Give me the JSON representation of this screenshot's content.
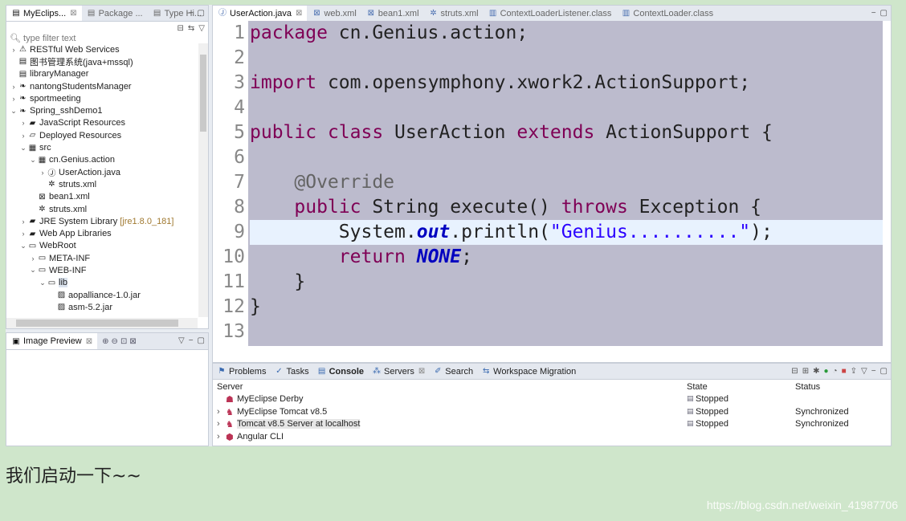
{
  "explorer": {
    "tabs": [
      {
        "label": "MyEclips...",
        "icon": "myeclipse-icon",
        "close": "⊠"
      },
      {
        "label": "Package ...",
        "icon": "package-explorer-icon"
      },
      {
        "label": "Type Hi...",
        "icon": "type-hierarchy-icon"
      }
    ],
    "filter_placeholder": "type filter text",
    "tree": [
      {
        "label": "RESTful Web Services",
        "arrow": "›",
        "icon": "⚠"
      },
      {
        "label": "图书管理系统(java+mssql)",
        "arrow": "",
        "icon": "▤"
      },
      {
        "label": "libraryManager",
        "arrow": "",
        "icon": "▤"
      },
      {
        "label": "nantongStudentsManager",
        "arrow": "›",
        "icon": "❧"
      },
      {
        "label": "sportmeeting",
        "arrow": "›",
        "icon": "❧"
      },
      {
        "label": "Spring_sshDemo1",
        "arrow": "⌄",
        "icon": "❧"
      },
      {
        "label": "JavaScript Resources",
        "arrow": "›",
        "icon": "▰"
      },
      {
        "label": "Deployed Resources",
        "arrow": "›",
        "icon": "▱"
      },
      {
        "label": "src",
        "arrow": "⌄",
        "icon": "▦"
      },
      {
        "label": "cn.Genius.action",
        "arrow": "⌄",
        "icon": "▦"
      },
      {
        "label": "UserAction.java",
        "arrow": "›",
        "icon": "Ⓙ"
      },
      {
        "label": "struts.xml",
        "arrow": "",
        "icon": "✲"
      },
      {
        "label": "bean1.xml",
        "arrow": "",
        "icon": "⊠"
      },
      {
        "label": "struts.xml",
        "arrow": "",
        "icon": "✲"
      },
      {
        "label": "JRE System Library",
        "decoration": "[jre1.8.0_181]",
        "arrow": "›",
        "icon": "▰"
      },
      {
        "label": "Web App Libraries",
        "arrow": "›",
        "icon": "▰"
      },
      {
        "label": "WebRoot",
        "arrow": "⌄",
        "icon": "▭"
      },
      {
        "label": "META-INF",
        "arrow": "›",
        "icon": "▭"
      },
      {
        "label": "WEB-INF",
        "arrow": "⌄",
        "icon": "▭"
      },
      {
        "label": "lib",
        "arrow": "⌄",
        "icon": "▭",
        "selected": true
      },
      {
        "label": "aopalliance-1.0.jar",
        "arrow": "",
        "icon": "▨"
      },
      {
        "label": "asm-5.2.jar",
        "arrow": "",
        "icon": "▨"
      }
    ]
  },
  "image_preview": {
    "title": "Image Preview",
    "close": "⊠"
  },
  "editor": {
    "tabs": [
      {
        "label": "UserAction.java",
        "icon": "Ⓙ",
        "active": true,
        "close": "⊠"
      },
      {
        "label": "web.xml",
        "icon": "⊠"
      },
      {
        "label": "bean1.xml",
        "icon": "⊠"
      },
      {
        "label": "struts.xml",
        "icon": "✲"
      },
      {
        "label": "ContextLoaderListener.class",
        "icon": "▥"
      },
      {
        "label": "ContextLoader.class",
        "icon": "▥"
      }
    ],
    "line_numbers": [
      "1",
      "2",
      "3",
      "4",
      "5",
      "6",
      "7",
      "8",
      "9",
      "10",
      "11",
      "12",
      "13"
    ],
    "current_line": 9,
    "code_lines": [
      [
        {
          "t": "package",
          "c": "kw"
        },
        {
          "t": " cn.Genius.action;"
        }
      ],
      [],
      [
        {
          "t": "import",
          "c": "kw"
        },
        {
          "t": " com.opensymphony.xwork2.ActionSupport;"
        }
      ],
      [],
      [
        {
          "t": "public",
          "c": "kw"
        },
        {
          "t": " "
        },
        {
          "t": "class",
          "c": "kw"
        },
        {
          "t": " UserAction "
        },
        {
          "t": "extends",
          "c": "kw"
        },
        {
          "t": " ActionSupport {"
        }
      ],
      [],
      [
        {
          "t": "    "
        },
        {
          "t": "@Override",
          "c": "an"
        }
      ],
      [
        {
          "t": "    "
        },
        {
          "t": "public",
          "c": "kw"
        },
        {
          "t": " String execute() "
        },
        {
          "t": "throws",
          "c": "kw"
        },
        {
          "t": " Exception {"
        }
      ],
      [
        {
          "t": "        System."
        },
        {
          "t": "out",
          "c": "fld"
        },
        {
          "t": ".println("
        },
        {
          "t": "\"Genius..........\"",
          "c": "st"
        },
        {
          "t": ");"
        }
      ],
      [
        {
          "t": "        "
        },
        {
          "t": "return",
          "c": "kw"
        },
        {
          "t": " "
        },
        {
          "t": "NONE",
          "c": "fld"
        },
        {
          "t": ";"
        }
      ],
      [
        {
          "t": "    }"
        }
      ],
      [
        {
          "t": "}"
        }
      ],
      []
    ]
  },
  "bottom": {
    "tabs": [
      {
        "label": "Problems",
        "icon": "⚑"
      },
      {
        "label": "Tasks",
        "icon": "✓"
      },
      {
        "label": "Console",
        "icon": "▤",
        "bold": true
      },
      {
        "label": "Servers",
        "icon": "⁂",
        "close": "⊠"
      },
      {
        "label": "Search",
        "icon": "✐"
      },
      {
        "label": "Workspace Migration",
        "icon": "⇆"
      }
    ],
    "columns": [
      "Server",
      "State",
      "Status"
    ],
    "rows": [
      {
        "name": "MyEclipse Derby",
        "arrow": "",
        "icon": "☗",
        "state": "Stopped",
        "status": ""
      },
      {
        "name": "MyEclipse Tomcat v8.5",
        "arrow": "›",
        "icon": "♞",
        "state": "Stopped",
        "status": "Synchronized"
      },
      {
        "name": "Tomcat v8.5 Server at localhost",
        "arrow": "›",
        "icon": "♞",
        "state": "Stopped",
        "status": "Synchronized",
        "highlight": true
      },
      {
        "name": "Angular CLI",
        "arrow": "›",
        "icon": "⬢",
        "state": "",
        "status": ""
      }
    ]
  },
  "caption": "我们启动一下~~",
  "watermark": "https://blog.csdn.net/weixin_41987706"
}
